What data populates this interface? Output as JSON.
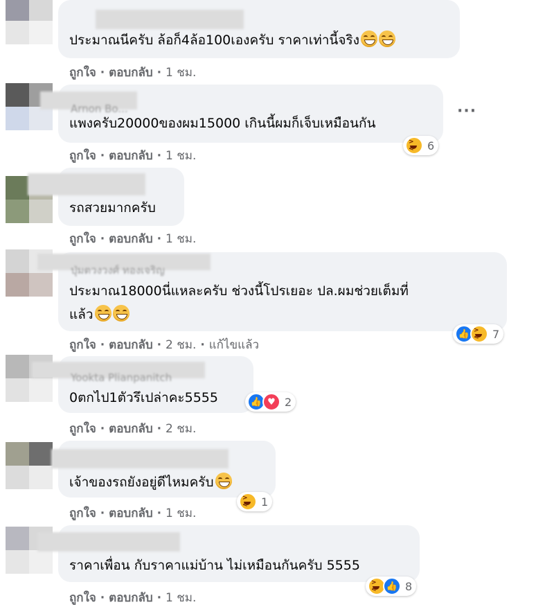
{
  "labels": {
    "like": "ถูกใจ",
    "reply": "ตอบกลับ",
    "sep": "·"
  },
  "comments": [
    {
      "text": "ประมาณนีครับ ล้อก็4ล้อ100เองครับ ราคาเท่านี้จริง",
      "emoji": [
        "grin-emoji",
        "grin-emoji"
      ],
      "time": "1 ชม.",
      "avatar_colors": [
        "#9a9aa6",
        "#d8d8d8",
        "#e6e6e6",
        "#f2f2f2"
      ]
    },
    {
      "name_ghost": "Arnon Bo...",
      "text": "แพงครับ20000ของผม15000 เกินนี้ผมก็เจ็บเหมือนกัน",
      "time": "1 ชม.",
      "reactions": {
        "icons": [
          "haha"
        ],
        "count": "6"
      },
      "avatar_colors": [
        "#5a5a5a",
        "#9e9e9e",
        "#cfd8ea",
        "#e3e7ef"
      ]
    },
    {
      "text": "รถสวยมากครับ",
      "time": "1 ชม.",
      "avatar_colors": [
        "#6b7b5a",
        "#b8b8a8",
        "#8c9a7a",
        "#d0d0c8"
      ]
    },
    {
      "name_ghost": "ปุ่มตวงวงศ์ ทองเจริญ",
      "text_lines": [
        "ประมาณ18000นี่แหละครับ ช่วงนี้โปรเยอะ ปล.ผมช่วยเต็มที่",
        "แล้ว"
      ],
      "emoji": [
        "grin-emoji",
        "grin-emoji"
      ],
      "time": "2 ชม.",
      "edited": "แก้ไขแล้ว",
      "reactions": {
        "icons": [
          "like",
          "haha"
        ],
        "count": "7"
      },
      "avatar_colors": [
        "#d4d4d4",
        "#e8e8e8",
        "#b9a8a3",
        "#cfc4c0"
      ]
    },
    {
      "name_ghost": "Yookta Plianpanitch",
      "text": "0ตกไป1ตัวรึเปล่าคะ5555",
      "time": "2 ชม.",
      "reactions": {
        "icons": [
          "like",
          "love"
        ],
        "count": "2"
      },
      "avatar_colors": [
        "#b8b8b8",
        "#d0d0d0",
        "#e2e2e2",
        "#efefef"
      ]
    },
    {
      "text": "เจ้าของรถยังอยู่ดีไหมครับ",
      "emoji": [
        "grin-emoji"
      ],
      "time": "1 ชม.",
      "reactions": {
        "icons": [
          "haha"
        ],
        "count": "1"
      },
      "avatar_colors": [
        "#a0a090",
        "#6e6e6e",
        "#dcdcdc",
        "#ececec"
      ]
    },
    {
      "text": "ราคาเพื่อน กับราคาแม่บ้าน ไม่เหมือนกันครับ 5555",
      "time": "1 ชม.",
      "reactions": {
        "icons": [
          "haha",
          "like"
        ],
        "count": "8"
      },
      "avatar_colors": [
        "#b8b8c0",
        "#d8d8d8",
        "#e6e6e6",
        "#f0f0f0"
      ]
    }
  ],
  "more_options_icon": "more-horizontal-icon",
  "more_options_label": "···"
}
